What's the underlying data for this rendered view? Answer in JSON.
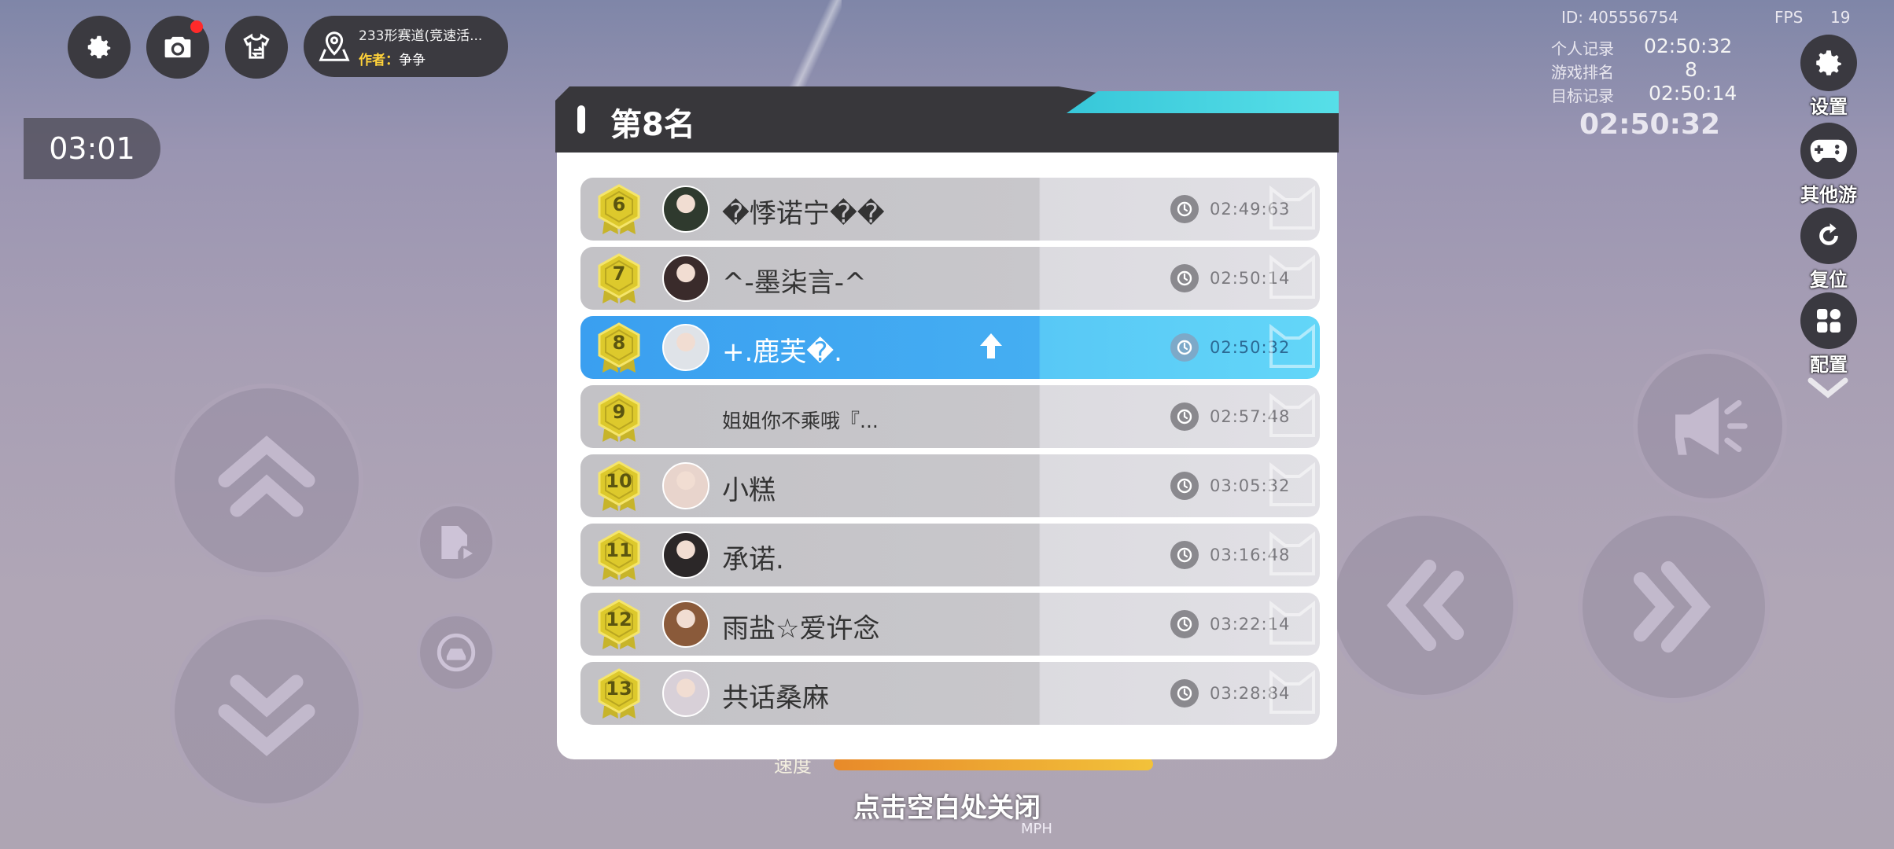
{
  "toolbar": {
    "map_name": "233形赛道(竞速活...",
    "author_label": "作者：",
    "author_name": "争争"
  },
  "race_timer": "03:01",
  "stats": {
    "id": "ID: 405556754",
    "fps_label": "FPS",
    "fps_value": "19",
    "personal_label": "个人记录",
    "personal_value": "02:50:32",
    "rank_label": "游戏排名",
    "rank_value": "8",
    "target_label": "目标记录",
    "target_value": "02:50:14",
    "current_time": "02:50:32"
  },
  "side_menu": [
    {
      "label": "设置",
      "icon": "gear-icon"
    },
    {
      "label": "其他游戏",
      "icon": "gamepad-icon"
    },
    {
      "label": "复位",
      "icon": "reset-icon"
    },
    {
      "label": "配置",
      "icon": "grid-icon"
    }
  ],
  "leaderboard": {
    "title": "第8名",
    "rows": [
      {
        "rank": "6",
        "name": "�悸诺宁��",
        "time": "02:49:63"
      },
      {
        "rank": "7",
        "name": "^-墨柒言-^",
        "time": "02:50:14"
      },
      {
        "rank": "8",
        "name": "+.鹿芙�.",
        "time": "02:50:32"
      },
      {
        "rank": "9",
        "name": "姐姐你不乘哦『...",
        "time": "02:57:48"
      },
      {
        "rank": "10",
        "name": "小糕",
        "time": "03:05:32"
      },
      {
        "rank": "11",
        "name": "承诺.",
        "time": "03:16:48"
      },
      {
        "rank": "12",
        "name": "雨盐☆爱许念",
        "time": "03:22:14"
      },
      {
        "rank": "13",
        "name": "共话桑麻",
        "time": "03:28:84"
      }
    ]
  },
  "bottom": {
    "speed_label": "速度",
    "close_hint": "点击空白处关闭",
    "unit": "MPH"
  },
  "colors": {
    "highlight_row": "#45aef2",
    "badge_gold": "#d9c42a",
    "accent_teal": "#4fd6e3"
  }
}
